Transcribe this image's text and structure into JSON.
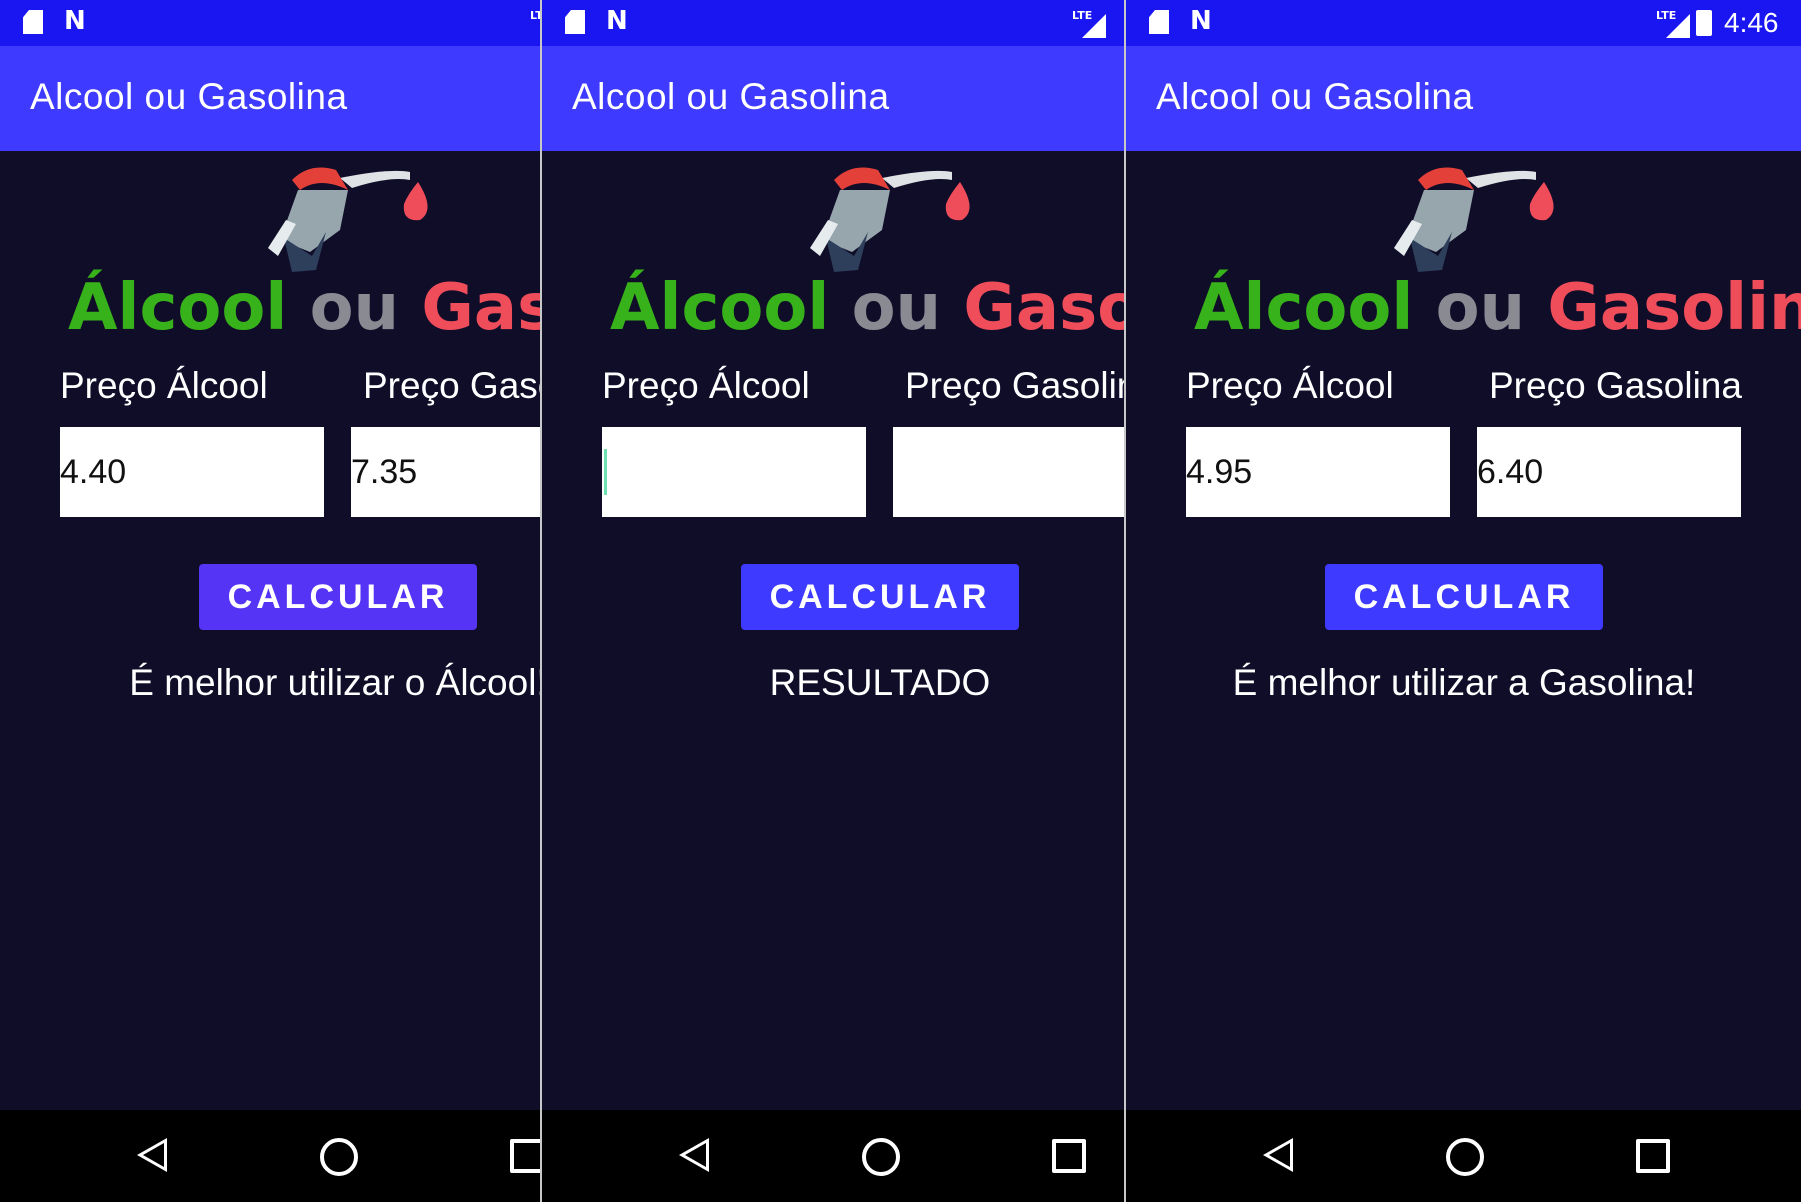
{
  "app": {
    "title": "Alcool ou Gasolina",
    "logo_words": [
      "Álcool",
      "ou",
      "Gasolina"
    ],
    "clock": "4:46",
    "status_network": "LTE"
  },
  "screens": [
    {
      "label_alcool": "Preço Álcool",
      "label_gasolina": "Preço Gasolina",
      "alcool_value": "4.40",
      "gasolina_value": "7.35",
      "button_label": "CALCULAR",
      "result": "É melhor utilizar o Álcool!"
    },
    {
      "label_alcool": "Preço Álcool",
      "label_gasolina": "Preço Gasolina",
      "alcool_value": "",
      "gasolina_value": "",
      "button_label": "CALCULAR",
      "result": "RESULTADO"
    },
    {
      "label_alcool": "Preço Álcool",
      "label_gasolina": "Preço Gasolina",
      "alcool_value": "4.95",
      "gasolina_value": "6.40",
      "button_label": "CALCULAR",
      "result": "É melhor utilizar a Gasolina!"
    }
  ],
  "colors": {
    "statusbar": "#1a16f1",
    "appbar": "#3e3aff",
    "background": "#100d29",
    "button": "#5534f5",
    "alcool_green": "#38b21a",
    "gas_red": "#f04d5b"
  },
  "icons": [
    "sd-card-icon",
    "n-logo-icon",
    "signal-icon",
    "battery-icon",
    "back-icon",
    "home-icon",
    "recents-icon",
    "fuel-pump-icon"
  ]
}
